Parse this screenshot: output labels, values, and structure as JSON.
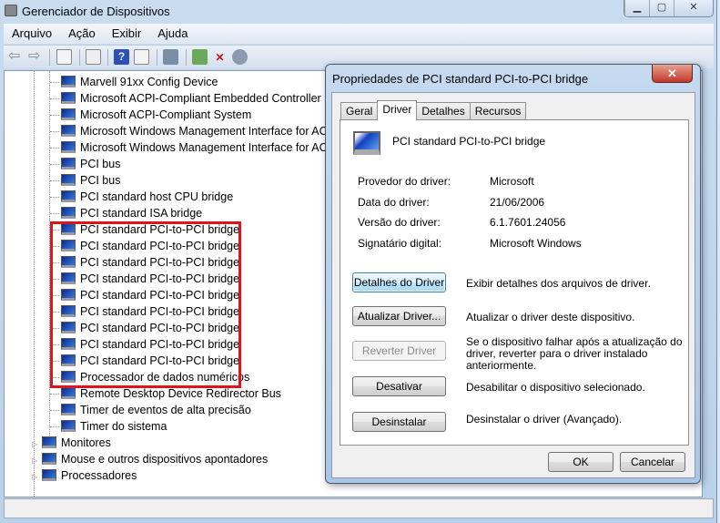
{
  "window": {
    "title": "Gerenciador de Dispositivos",
    "controls": [
      "minimize",
      "maximize",
      "close"
    ]
  },
  "menu": [
    "Arquivo",
    "Ação",
    "Exibir",
    "Ajuda"
  ],
  "toolbar": [
    "back-icon",
    "forward-icon",
    "show-hide-console-tree-icon",
    "properties-icon",
    "help-icon",
    "action-pane-icon",
    "scan-hardware-icon",
    "update-driver-icon",
    "disable-device-icon",
    "uninstall-device-icon"
  ],
  "tree": {
    "children": [
      "Marvell 91xx Config Device",
      "Microsoft ACPI-Compliant Embedded Controller",
      "Microsoft ACPI-Compliant System",
      "Microsoft Windows Management Interface for ACPI",
      "Microsoft Windows Management Interface for ACPI",
      "PCI bus",
      "PCI bus",
      "PCI standard host CPU bridge",
      "PCI standard ISA bridge",
      "PCI standard PCI-to-PCI bridge",
      "PCI standard PCI-to-PCI bridge",
      "PCI standard PCI-to-PCI bridge",
      "PCI standard PCI-to-PCI bridge",
      "PCI standard PCI-to-PCI bridge",
      "PCI standard PCI-to-PCI bridge",
      "PCI standard PCI-to-PCI bridge",
      "PCI standard PCI-to-PCI bridge",
      "PCI standard PCI-to-PCI bridge",
      "Processador de dados numéricos",
      "Remote Desktop Device Redirector Bus",
      "Timer de eventos de alta precisão",
      "Timer do sistema"
    ],
    "categories": [
      "Monitores",
      "Mouse e outros dispositivos apontadores",
      "Processadores"
    ],
    "highlight_color": "#e0141c"
  },
  "dialog": {
    "title": "Propriedades de PCI standard PCI-to-PCI bridge",
    "tabs": [
      "Geral",
      "Driver",
      "Detalhes",
      "Recursos"
    ],
    "active_tab": "Driver",
    "device_name": "PCI standard PCI-to-PCI bridge",
    "fields": [
      {
        "label": "Provedor do driver:",
        "value": "Microsoft"
      },
      {
        "label": "Data do driver:",
        "value": "21/06/2006"
      },
      {
        "label": "Versão do driver:",
        "value": "6.1.7601.24056"
      },
      {
        "label": "Signatário digital:",
        "value": "Microsoft Windows"
      }
    ],
    "actions": [
      {
        "button": "Detalhes do Driver",
        "desc": "Exibir detalhes dos arquivos de driver.",
        "enabled": true
      },
      {
        "button": "Atualizar Driver...",
        "desc": "Atualizar o driver deste dispositivo.",
        "enabled": true
      },
      {
        "button": "Reverter Driver",
        "desc": "Se o dispositivo falhar após a atualização do driver, reverter para o driver instalado anteriormente.",
        "enabled": false
      },
      {
        "button": "Desativar",
        "desc": "Desabilitar o dispositivo selecionado.",
        "enabled": true
      },
      {
        "button": "Desinstalar",
        "desc": "Desinstalar o driver (Avançado).",
        "enabled": true
      }
    ],
    "ok": "OK",
    "cancel": "Cancelar"
  }
}
